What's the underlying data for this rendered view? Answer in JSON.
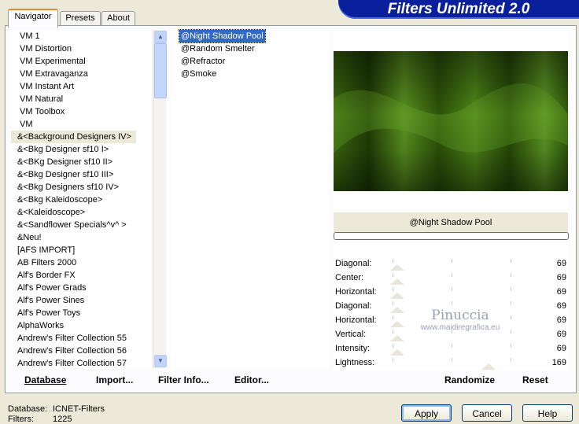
{
  "banner": {
    "title": "Filters Unlimited 2.0"
  },
  "tabs": [
    {
      "label": "Navigator"
    },
    {
      "label": "Presets"
    },
    {
      "label": "About"
    }
  ],
  "categories": [
    "VM 1",
    "VM Distortion",
    "VM Experimental",
    "VM Extravaganza",
    "VM Instant Art",
    "VM Natural",
    "VM Toolbox",
    "VM",
    "&<Background Designers IV>",
    "&<Bkg Designer sf10 I>",
    "&<BKg Designer sf10 II>",
    "&<Bkg Designer sf10 III>",
    "&<Bkg Designers sf10 IV>",
    "&<Bkg Kaleidoscope>",
    "&<Kaleidoscope>",
    "&<Sandflower Specials^v^ >",
    "&Neu!",
    "[AFS IMPORT]",
    "AB Filters 2000",
    "Alf's Border FX",
    "Alf's Power Grads",
    "Alf's Power Sines",
    "Alf's Power Toys",
    "AlphaWorks",
    "Andrew's Filter Collection 55",
    "Andrew's Filter Collection 56",
    "Andrew's Filter Collection 57"
  ],
  "selected_category": "&<Background Designers IV>",
  "filters": [
    "@Night Shadow Pool",
    "@Random Smelter",
    "@Refractor",
    "@Smoke"
  ],
  "selected_filter": "@Night Shadow Pool",
  "preview": {
    "filter_name": "@Night Shadow Pool"
  },
  "params": [
    {
      "label": "Diagonal:",
      "value": "69"
    },
    {
      "label": "Center:",
      "value": "69"
    },
    {
      "label": "Horizontal:",
      "value": "69"
    },
    {
      "label": "Diagonal:",
      "value": "69"
    },
    {
      "label": "Horizontal:",
      "value": "69"
    },
    {
      "label": "Vertical:",
      "value": "69"
    },
    {
      "label": "Intensity:",
      "value": "69"
    },
    {
      "label": "Lightness:",
      "value": "169"
    }
  ],
  "watermark": {
    "name": "Pinuccia",
    "url": "www.maidiregrafica.eu"
  },
  "bottom_buttons": {
    "database": "Database",
    "import": "Import...",
    "filter_info": "Filter Info...",
    "editor": "Editor...",
    "randomize": "Randomize",
    "reset": "Reset"
  },
  "status": {
    "database_label": "Database:",
    "database_value": "ICNET-Filters",
    "filters_label": "Filters:",
    "filters_value": "1225"
  },
  "dialog_buttons": {
    "apply": "Apply",
    "cancel": "Cancel",
    "help": "Help"
  }
}
